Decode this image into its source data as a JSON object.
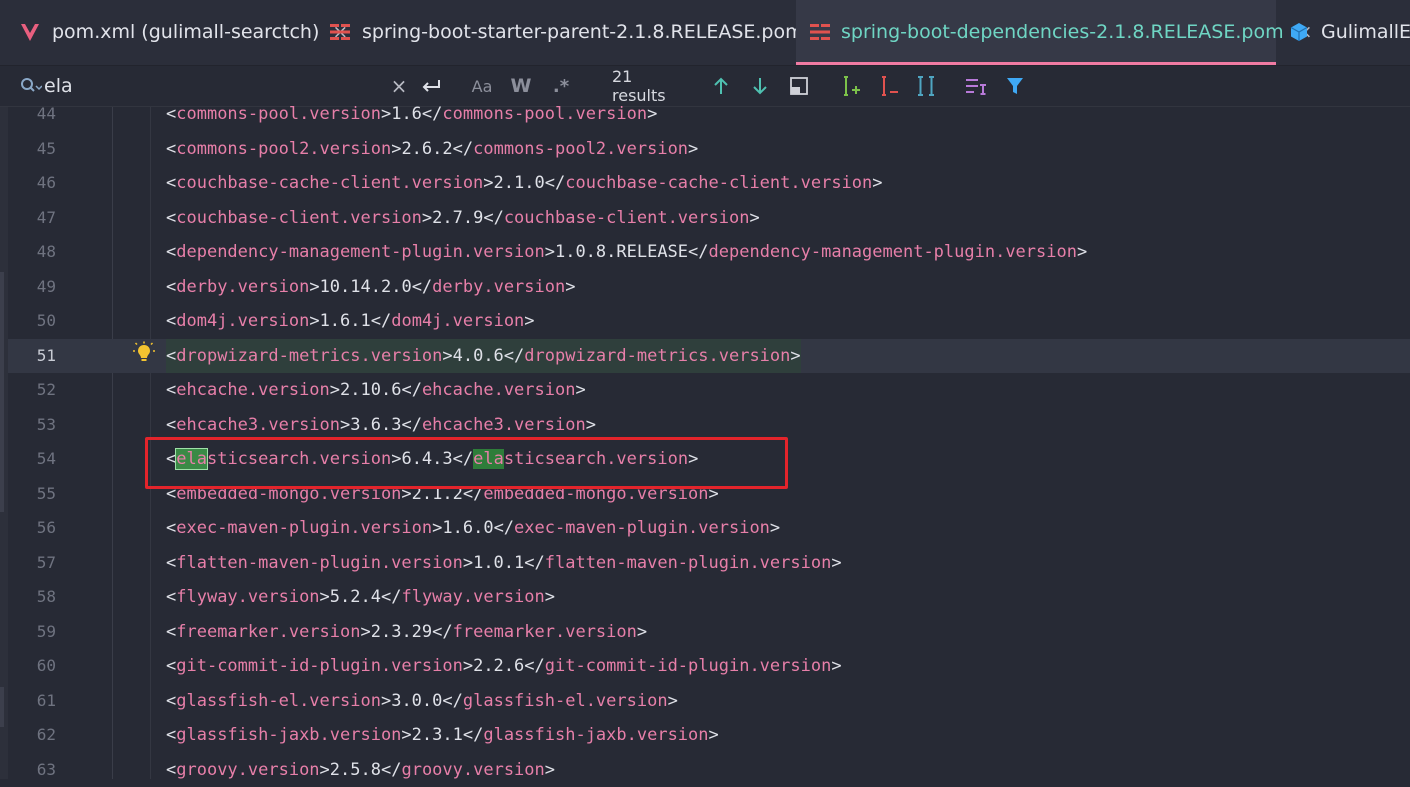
{
  "tabs": [
    {
      "label": "pom.xml (gulimall-searctch)",
      "icon": "vue-icon",
      "active": false,
      "close": "×"
    },
    {
      "label": "spring-boot-starter-parent-2.1.8.RELEASE.pom",
      "icon": "maven-icon",
      "active": false,
      "close": "×"
    },
    {
      "label": "spring-boot-dependencies-2.1.8.RELEASE.pom",
      "icon": "maven-icon",
      "active": true,
      "close": "×"
    },
    {
      "label": "GulimallEla",
      "icon": "cube-icon",
      "active": false,
      "close": ""
    }
  ],
  "search": {
    "value": "ela",
    "placeholder": "",
    "clear": "×",
    "match_case": "Aa",
    "whole_words": "W",
    "regex": ".*",
    "results": "21 results"
  },
  "editor": {
    "lines": [
      {
        "num": "44",
        "tag": "commons-pool.version",
        "value": "1.6"
      },
      {
        "num": "45",
        "tag": "commons-pool2.version",
        "value": "2.6.2"
      },
      {
        "num": "46",
        "tag": "couchbase-cache-client.version",
        "value": "2.1.0"
      },
      {
        "num": "47",
        "tag": "couchbase-client.version",
        "value": "2.7.9"
      },
      {
        "num": "48",
        "tag": "dependency-management-plugin.version",
        "value": "1.0.8.RELEASE"
      },
      {
        "num": "49",
        "tag": "derby.version",
        "value": "10.14.2.0"
      },
      {
        "num": "50",
        "tag": "dom4j.version",
        "value": "1.6.1"
      },
      {
        "num": "51",
        "tag": "dropwizard-metrics.version",
        "value": "4.0.6",
        "current": true
      },
      {
        "num": "52",
        "tag": "ehcache.version",
        "value": "2.10.6"
      },
      {
        "num": "53",
        "tag": "ehcache3.version",
        "value": "3.6.3"
      },
      {
        "num": "54",
        "tag": "elasticsearch.version",
        "value": "6.4.3",
        "match": "ela"
      },
      {
        "num": "55",
        "tag": "embedded-mongo.version",
        "value": "2.1.2"
      },
      {
        "num": "56",
        "tag": "exec-maven-plugin.version",
        "value": "1.6.0"
      },
      {
        "num": "57",
        "tag": "flatten-maven-plugin.version",
        "value": "1.0.1"
      },
      {
        "num": "58",
        "tag": "flyway.version",
        "value": "5.2.4"
      },
      {
        "num": "59",
        "tag": "freemarker.version",
        "value": "2.3.29"
      },
      {
        "num": "60",
        "tag": "git-commit-id-plugin.version",
        "value": "2.2.6"
      },
      {
        "num": "61",
        "tag": "glassfish-el.version",
        "value": "3.0.0"
      },
      {
        "num": "62",
        "tag": "glassfish-jaxb.version",
        "value": "2.3.1"
      },
      {
        "num": "63",
        "tag": "groovy.version",
        "value": "2.5.8"
      }
    ]
  },
  "colors": {
    "tag": "#e77fa9",
    "active_tab_text": "#6fd6c4",
    "match_bg": "#2e7d3a",
    "annotation": "#e3242b"
  }
}
